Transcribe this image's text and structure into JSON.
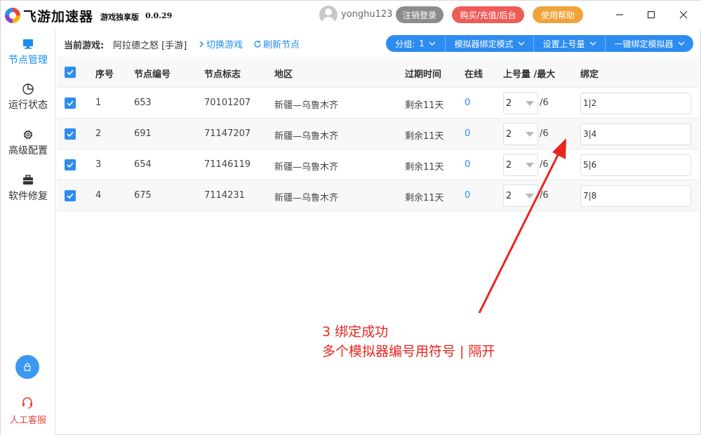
{
  "app": {
    "name": "飞游加速器",
    "subtitle": "游戏独享版",
    "version": "0.0.29"
  },
  "user": {
    "name": "yonghu123",
    "logout_label": "注销登录",
    "buy_label": "购买/充值/后台",
    "help_label": "使用帮助"
  },
  "sidebar": {
    "items": [
      {
        "label": "节点管理",
        "icon": "monitor-icon",
        "active": true
      },
      {
        "label": "运行状态",
        "icon": "pie-chart-icon",
        "active": false
      },
      {
        "label": "高级配置",
        "icon": "gear-icon",
        "active": false
      },
      {
        "label": "软件修复",
        "icon": "toolbox-icon",
        "active": false
      }
    ],
    "lock_icon": "lock-icon",
    "support_label": "人工客服"
  },
  "toolbar": {
    "current_game_label": "当前游戏:",
    "current_game": "阿拉德之怒 [手游]",
    "switch_game": "切换游戏",
    "refresh_nodes": "刷新节点",
    "group_btn": "分组:",
    "group_value": "1",
    "emulator_mode": "模拟器绑定模式",
    "set_login_count": "设置上号量",
    "bind_all": "一键绑定模拟器"
  },
  "table": {
    "headers": {
      "index": "序号",
      "node_no": "节点编号",
      "node_tag": "节点标志",
      "region": "地区",
      "expire": "过期时间",
      "online": "在线",
      "login_max": "上号量 /最大",
      "bind": "绑定"
    },
    "rows": [
      {
        "index": "1",
        "node_no": "653",
        "node_tag": "70101207",
        "region": "新疆—乌鲁木齐",
        "expire": "剩余11天",
        "online": "0",
        "login": "2",
        "max": "/6",
        "bind": "1|2"
      },
      {
        "index": "2",
        "node_no": "691",
        "node_tag": "71147207",
        "region": "新疆—乌鲁木齐",
        "expire": "剩余11天",
        "online": "0",
        "login": "2",
        "max": "/6",
        "bind": "3|4"
      },
      {
        "index": "3",
        "node_no": "654",
        "node_tag": "71146119",
        "region": "新疆—乌鲁木齐",
        "expire": "剩余11天",
        "online": "0",
        "login": "2",
        "max": "/6",
        "bind": "5|6"
      },
      {
        "index": "4",
        "node_no": "675",
        "node_tag": "7114231",
        "region": "新疆—乌鲁木齐",
        "expire": "剩余11天",
        "online": "0",
        "login": "2",
        "max": "/6",
        "bind": "7|8"
      }
    ]
  },
  "annotation": {
    "line1": "3 绑定成功",
    "line2": "多个模拟器编号用符号 | 隔开",
    "color": "#e8251c"
  },
  "colors": {
    "accent": "#2d8cf0",
    "logout": "#8c8c8c",
    "buy": "#ee5c57",
    "help": "#f0a33a",
    "support": "#e8453c"
  }
}
